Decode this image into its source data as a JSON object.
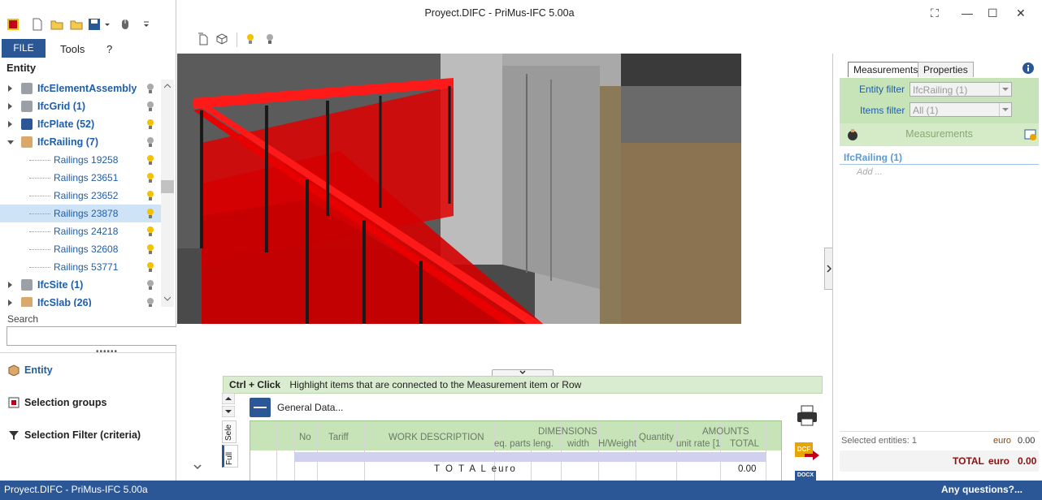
{
  "app": {
    "title": "Proyect.DIFC - PriMus-IFC  5.00a"
  },
  "menu": {
    "file": "FILE",
    "tools": "Tools",
    "help": "?"
  },
  "tree": {
    "header": "Entity",
    "items": [
      {
        "label": "IfcElementAssembly",
        "top": true,
        "expanded": false
      },
      {
        "label": "IfcGrid (1)",
        "top": true,
        "expanded": false
      },
      {
        "label": "IfcPlate (52)",
        "top": true,
        "expanded": false
      },
      {
        "label": "IfcRailing (7)",
        "top": true,
        "expanded": true
      },
      {
        "label": "Railings 19258",
        "top": false
      },
      {
        "label": "Railings 23651",
        "top": false
      },
      {
        "label": "Railings 23652",
        "top": false
      },
      {
        "label": "Railings 23878",
        "top": false,
        "selected": true
      },
      {
        "label": "Railings 24218",
        "top": false
      },
      {
        "label": "Railings 32608",
        "top": false
      },
      {
        "label": "Railings 53771",
        "top": false
      },
      {
        "label": "IfcSite (1)",
        "top": true,
        "expanded": false
      },
      {
        "label": "IfcSlab (26)",
        "top": true,
        "expanded": false
      }
    ]
  },
  "search": {
    "label": "Search",
    "value": ""
  },
  "nav": {
    "entity": "Entity",
    "selection_groups": "Selection groups",
    "selection_filter": "Selection Filter (criteria)"
  },
  "hint": {
    "key": "Ctrl + Click",
    "text": "Highlight items that are connected to the Measurement item or Row"
  },
  "lower": {
    "general_data": "General Data...",
    "tab_full": "Full",
    "tab_sele": "Sele",
    "columns": {
      "no": "No",
      "tariff": "Tariff",
      "work_description": "WORK DESCRIPTION",
      "dimensions": "DIMENSIONS",
      "eq_parts": "eq. parts",
      "length": "leng.",
      "width": "width",
      "hweight": "H/Weight",
      "quantity": "Quantity",
      "amounts": "AMOUNTS",
      "unit_rate": "unit rate [1",
      "total": "TOTAL"
    },
    "total_label": "T O T A L  euro",
    "total_value": "0.00"
  },
  "right": {
    "tab_measurements": "Measurements",
    "tab_properties": "Properties",
    "entity_filter_label": "Entity filter",
    "entity_filter_value": "IfcRailing (1)",
    "items_filter_label": "Items filter",
    "items_filter_value": "All (1)",
    "measurements_title": "Measurements",
    "group_title": "IfcRailing (1)",
    "add": "Add ...",
    "selected_entities": "Selected entities: 1",
    "selected_currency": "euro",
    "selected_value": "0.00",
    "total_label": "TOTAL",
    "total_currency": "euro",
    "total_value": "0.00"
  },
  "side_buttons": {
    "dcf": "DCF",
    "docx": "DOCX"
  },
  "status": {
    "left": "Proyect.DIFC - PriMus-IFC  5.00a",
    "right": "Any questions?..."
  },
  "colors": {
    "accent": "#2b5797",
    "green_panel": "#c7e3b8",
    "railing_red": "#e00000"
  }
}
